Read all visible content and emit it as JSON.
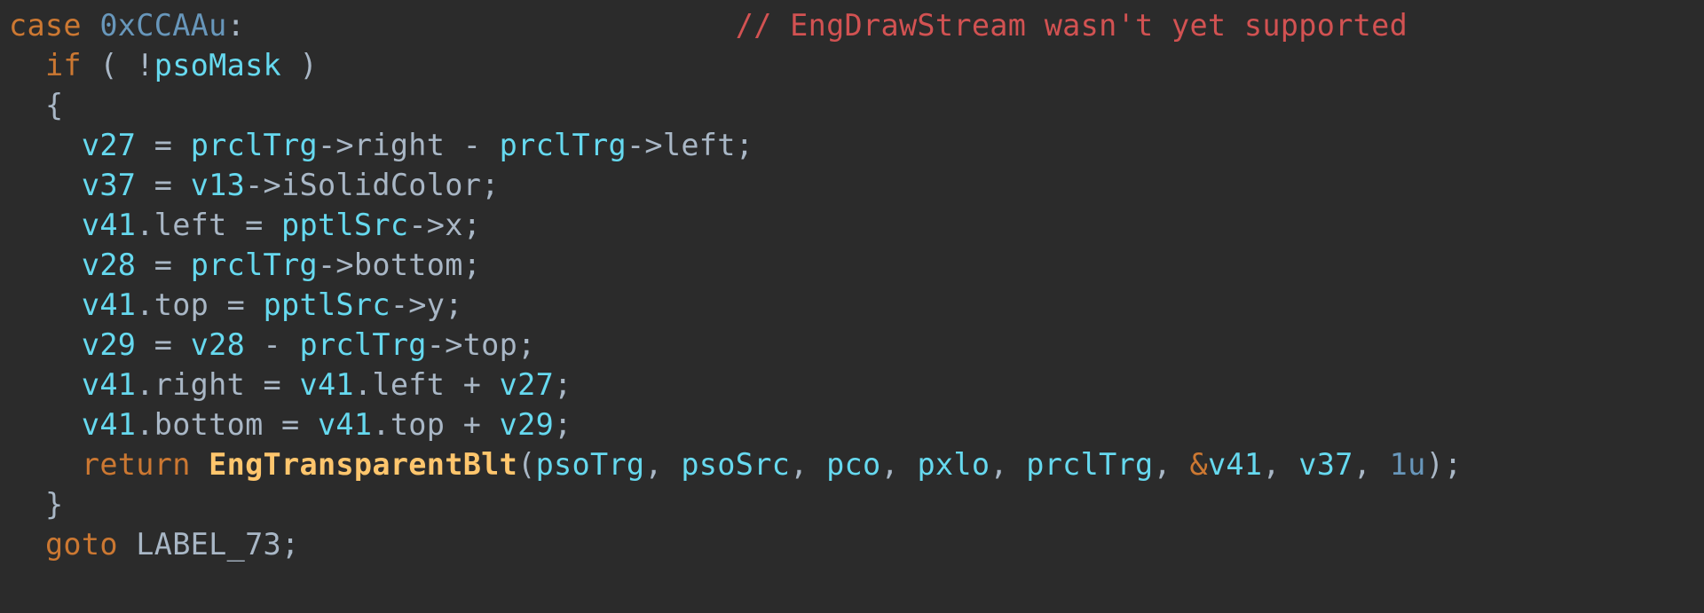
{
  "comment": "// EngDrawStream wasn't yet supported",
  "kw": {
    "case": "case",
    "if": "if",
    "return": "return",
    "goto": "goto"
  },
  "case_val": "0xCCAAu",
  "cond_open": "( !",
  "cond_var": "psoMask",
  "cond_close": " )",
  "l1": {
    "lhs": "v27",
    "eq": " = ",
    "a": "prclTrg",
    "arrow1": "->",
    "m1": "right",
    "minus": " - ",
    "b": "prclTrg",
    "arrow2": "->",
    "m2": "left"
  },
  "l2": {
    "lhs": "v37",
    "eq": " = ",
    "a": "v13",
    "arrow": "->",
    "m": "iSolidColor"
  },
  "l3": {
    "lhs": "v41",
    "dot": ".",
    "mem": "left",
    "eq": " = ",
    "a": "pptlSrc",
    "arrow": "->",
    "m": "x"
  },
  "l4": {
    "lhs": "v28",
    "eq": " = ",
    "a": "prclTrg",
    "arrow": "->",
    "m": "bottom"
  },
  "l5": {
    "lhs": "v41",
    "dot": ".",
    "mem": "top",
    "eq": " = ",
    "a": "pptlSrc",
    "arrow": "->",
    "m": "y"
  },
  "l6": {
    "lhs": "v29",
    "eq": " = ",
    "a": "v28",
    "minus": " - ",
    "b": "prclTrg",
    "arrow": "->",
    "m": "top"
  },
  "l7": {
    "lhs": "v41",
    "dot": ".",
    "mem": "right",
    "eq": " = ",
    "a": "v41",
    "dot2": ".",
    "m": "left",
    "plus": " + ",
    "b": "v27"
  },
  "l8": {
    "lhs": "v41",
    "dot": ".",
    "mem": "bottom",
    "eq": " = ",
    "a": "v41",
    "dot2": ".",
    "m": "top",
    "plus": " + ",
    "b": "v29"
  },
  "call": {
    "fn": "EngTransparentBlt",
    "args": {
      "a1": "psoTrg",
      "a2": "psoSrc",
      "a3": "pco",
      "a4": "pxlo",
      "a5": "prclTrg",
      "amp": "&",
      "a6": "v41",
      "a7": "v37",
      "a8": "1u"
    }
  },
  "label": "LABEL_73",
  "punct": {
    "colon": ":",
    "semi": ";",
    "ob": "{",
    "cb": "}",
    "op": "(",
    "cp": ")",
    "comma": ", "
  }
}
